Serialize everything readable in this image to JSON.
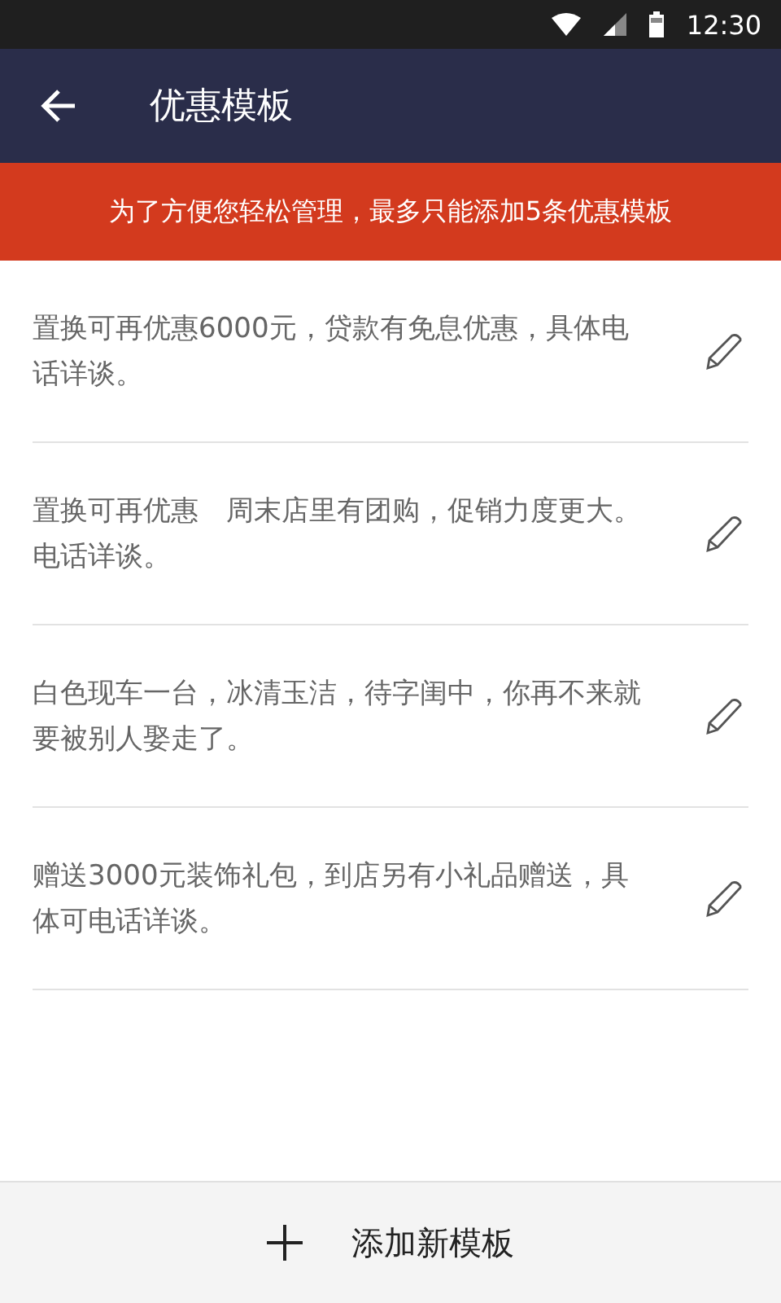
{
  "status_bar": {
    "time": "12:30"
  },
  "app_bar": {
    "title": "优惠模板"
  },
  "notice": "为了方便您轻松管理，最多只能添加5条优惠模板",
  "templates": [
    {
      "text": "置换可再优惠6000元，贷款有免息优惠，具体电话详谈。"
    },
    {
      "text": "置换可再优惠　周末店里有团购，促销力度更大。电话详谈。"
    },
    {
      "text": "白色现车一台，冰清玉洁，待字闺中，你再不来就要被别人娶走了。"
    },
    {
      "text": "赠送3000元装饰礼包，到店另有小礼品赠送，具体可电话详谈。"
    }
  ],
  "add_button": {
    "label": "添加新模板"
  }
}
